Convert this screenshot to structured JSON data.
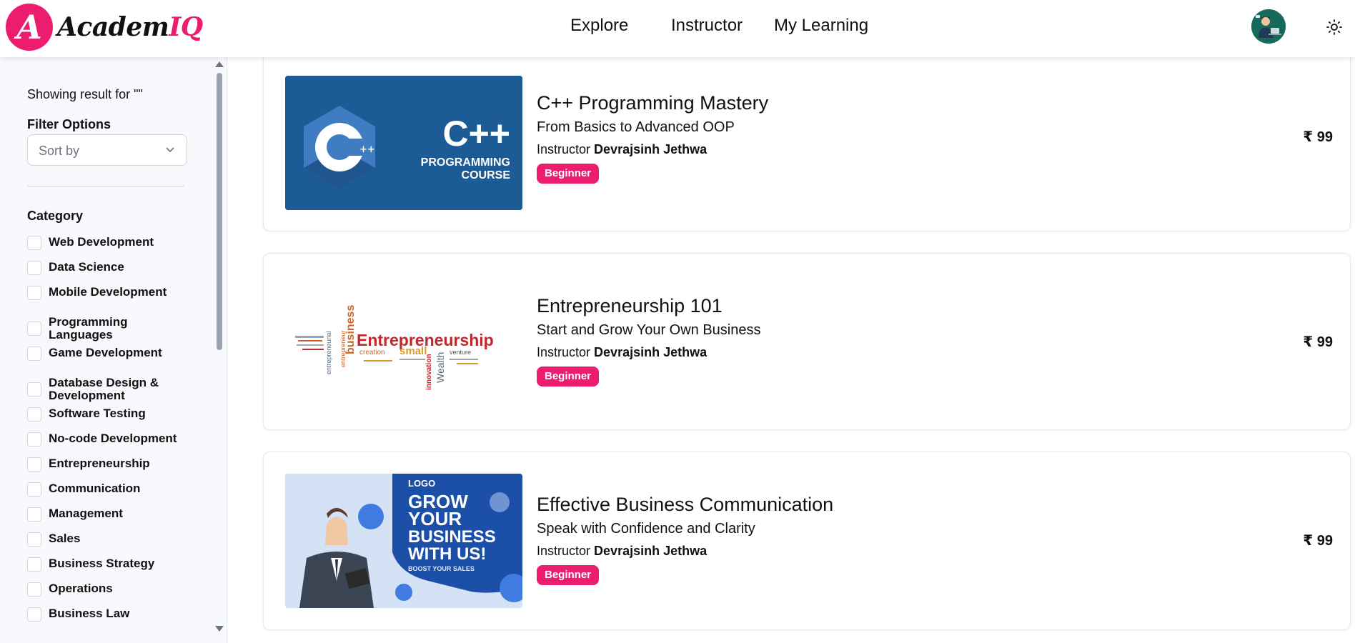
{
  "brand": {
    "mark": "A",
    "name_main": "Academ",
    "name_accent": "IQ",
    "accent_color": "#ec1c6e"
  },
  "nav": {
    "items": [
      "Explore",
      "Instructor",
      "My Learning"
    ]
  },
  "header": {
    "avatar_icon": "user-avatar",
    "theme_icon": "sun-icon"
  },
  "sidebar": {
    "showing_text": "Showing result for \"\"",
    "filter_title": "Filter Options",
    "sort_placeholder": "Sort by",
    "category_title": "Category",
    "categories": [
      "Web Development",
      "Data Science",
      "Mobile Development",
      "Programming Languages",
      "Game Development",
      "Database Design & Development",
      "Software Testing",
      "No-code Development",
      "Entrepreneurship",
      "Communication",
      "Management",
      "Sales",
      "Business Strategy",
      "Operations",
      "Business Law"
    ]
  },
  "courses": [
    {
      "title": "C++ Programming Mastery",
      "subtitle": "From Basics to Advanced OOP",
      "instructor_label": "Instructor",
      "instructor": "Devrajsinh Jethwa",
      "level": "Beginner",
      "price": "₹ 99",
      "thumb_lines": [
        "C++",
        "PROGRAMMING",
        "COURSE"
      ]
    },
    {
      "title": "Entrepreneurship 101",
      "subtitle": "Start and Grow Your Own Business",
      "instructor_label": "Instructor",
      "instructor": "Devrajsinh Jethwa",
      "level": "Beginner",
      "price": "₹ 99",
      "thumb_lines": [
        "Entrepreneurship",
        "business",
        "small",
        "creation",
        "venture",
        "innovation",
        "Wealth",
        "entrepreneur",
        "entrepreneurial"
      ]
    },
    {
      "title": "Effective Business Communication",
      "subtitle": "Speak with Confidence and Clarity",
      "instructor_label": "Instructor",
      "instructor": "Devrajsinh Jethwa",
      "level": "Beginner",
      "price": "₹ 99",
      "thumb_lines": [
        "LOGO",
        "GROW",
        "YOUR",
        "BUSINESS",
        "WITH US!",
        "BOOST YOUR SALES"
      ]
    }
  ]
}
